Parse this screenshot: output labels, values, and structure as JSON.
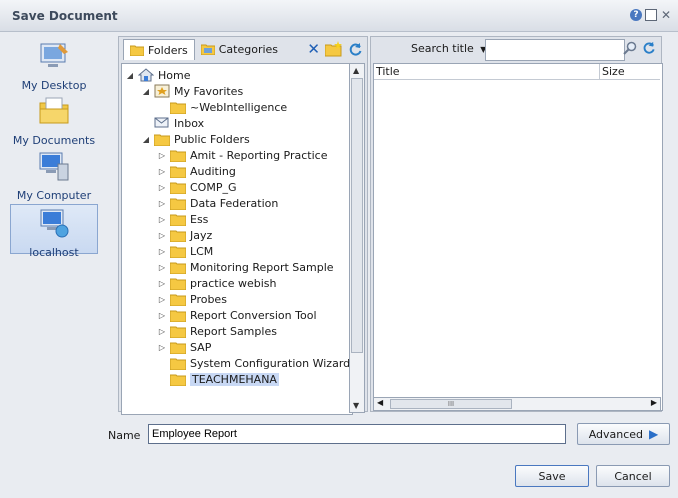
{
  "window": {
    "title": "Save Document"
  },
  "places": [
    {
      "label": "My Desktop"
    },
    {
      "label": "My Documents"
    },
    {
      "label": "My Computer"
    },
    {
      "label": "localhost"
    }
  ],
  "tabs": {
    "folders": "Folders",
    "categories": "Categories"
  },
  "tree": {
    "home": "Home",
    "my_favorites": "My Favorites",
    "webintelligence": "~WebIntelligence",
    "inbox": "Inbox",
    "public_folders": "Public Folders",
    "folders": [
      "Amit - Reporting Practice",
      "Auditing",
      "COMP_G",
      "Data Federation",
      "Ess",
      "Jayz",
      "LCM",
      "Monitoring Report Sample",
      "practice webish",
      "Probes",
      "Report Conversion Tool",
      "Report Samples",
      "SAP",
      "System Configuration Wizard",
      "TEACHMEHANA"
    ]
  },
  "search": {
    "label": "Search title",
    "value": ""
  },
  "list": {
    "columns": [
      "Title",
      "Size"
    ],
    "scroll_label": "III"
  },
  "name_field": {
    "label": "Name",
    "value": "Employee Report"
  },
  "buttons": {
    "advanced": "Advanced",
    "save": "Save",
    "cancel": "Cancel"
  },
  "colors": {
    "accent": "#3b7dd8",
    "folder": "#f5c842"
  }
}
